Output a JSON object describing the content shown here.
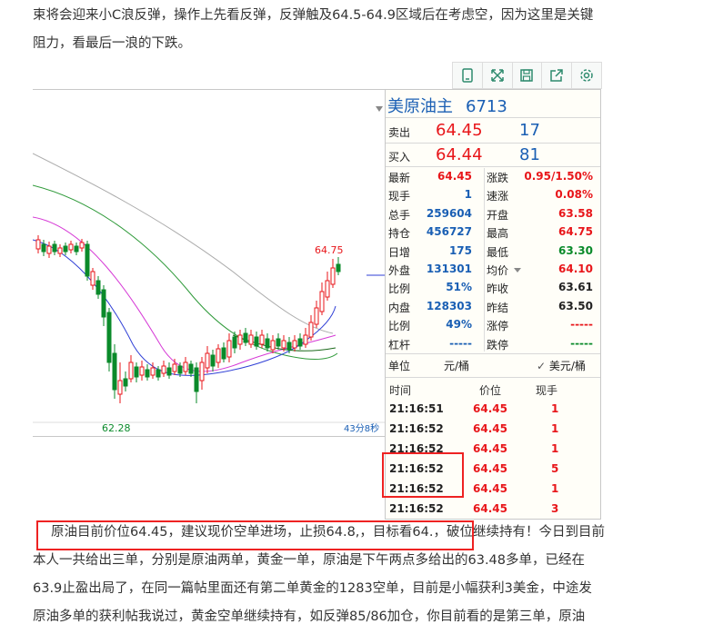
{
  "article": {
    "para1_line1": "束将会迎来小C浪反弹，操作上先看反弹，反弹触及64.5-64.9区域后在考虑空，因为这里是关键",
    "para1_line2": "阻力，看最后一浪的下跌。",
    "para2_line1_highlight": "原油目前价位64.45，建议现价空单进场，止损64.8,，目标看64.，",
    "para2_line1_rest": "破位继续持有！今日到目前",
    "para2_line2": "本人一共给出三单，分别是原油两单，黄金一单，原油是下午两点多给出的63.48多单，已经在",
    "para2_line3": "63.9止盈出局了，在同一篇帖里面还有第二单黄金的1283空单，目前是小幅获利3美金，中途发",
    "para2_line4": "原油多单的获利帖我说过，黄金空单继续持有，如反弹85/86加仓，你目前看的是第三单，原油"
  },
  "toolbar": {
    "icons": [
      "phone-icon",
      "expand-icon",
      "save-icon",
      "share-icon",
      "settings-icon"
    ]
  },
  "chart": {
    "high_label": "64.75",
    "low_label": "62.28",
    "time_label": "43分8秒"
  },
  "quote": {
    "title": "美原油主",
    "code": "6713",
    "sell_label": "卖出",
    "sell_price": "64.45",
    "sell_vol": "17",
    "buy_label": "买入",
    "buy_price": "64.44",
    "buy_vol": "81",
    "stats": [
      {
        "l1": "最新",
        "v1": "64.45",
        "c1": "red",
        "l2": "涨跌",
        "v2": "0.95/1.50%",
        "c2": "red"
      },
      {
        "l1": "现手",
        "v1": "1",
        "c1": "blue",
        "l2": "速涨",
        "v2": "0.08%",
        "c2": "red"
      },
      {
        "l1": "总手",
        "v1": "259604",
        "c1": "blue",
        "l2": "开盘",
        "v2": "63.58",
        "c2": "red"
      },
      {
        "l1": "持仓",
        "v1": "456727",
        "c1": "blue",
        "l2": "最高",
        "v2": "64.75",
        "c2": "red"
      },
      {
        "l1": "日增",
        "v1": "175",
        "c1": "blue",
        "l2": "最低",
        "v2": "63.30",
        "c2": "green"
      },
      {
        "l1": "外盘",
        "v1": "131301",
        "c1": "blue",
        "l2": "均价",
        "v2": "64.10",
        "c2": "red"
      },
      {
        "l1": "比例",
        "v1": "51%",
        "c1": "blue",
        "l2": "昨收",
        "v2": "63.61",
        "c2": "dark"
      },
      {
        "l1": "内盘",
        "v1": "128303",
        "c1": "blue",
        "l2": "昨结",
        "v2": "63.50",
        "c2": "dark"
      },
      {
        "l1": "比例",
        "v1": "49%",
        "c1": "blue",
        "l2": "涨停",
        "v2": "-----",
        "c2": "red"
      },
      {
        "l1": "杠杆",
        "v1": "-----",
        "c1": "blue",
        "l2": "跌停",
        "v2": "-----",
        "c2": "green"
      }
    ],
    "unit_label": "单位",
    "unit_value": "元/桶",
    "unit_select": "美元/桶",
    "ticks_header": {
      "time": "时间",
      "price": "价位",
      "vol": "现手"
    },
    "ticks": [
      {
        "time": "21:16:51",
        "price": "64.45",
        "vol": "1"
      },
      {
        "time": "21:16:52",
        "price": "64.45",
        "vol": "1"
      },
      {
        "time": "21:16:52",
        "price": "64.45",
        "vol": "1"
      },
      {
        "time": "21:16:52",
        "price": "64.45",
        "vol": "5"
      },
      {
        "time": "21:16:52",
        "price": "64.45",
        "vol": "1"
      },
      {
        "time": "21:16:52",
        "price": "64.45",
        "vol": "3"
      }
    ]
  }
}
